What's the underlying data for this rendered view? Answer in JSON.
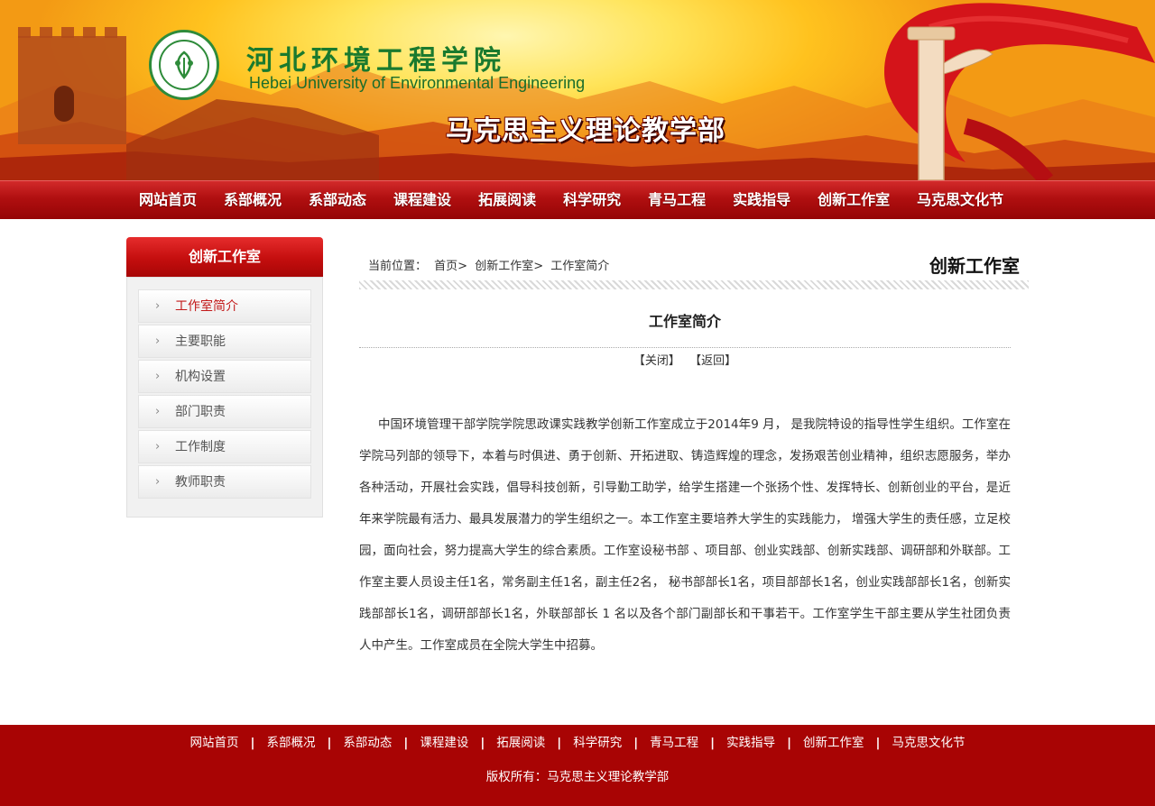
{
  "header": {
    "school_name_cn": "河北环境工程学院",
    "school_name_en": "Hebei University of Environmental Engineering",
    "department_title": "马克思主义理论教学部"
  },
  "nav": {
    "items": [
      "网站首页",
      "系部概况",
      "系部动态",
      "课程建设",
      "拓展阅读",
      "科学研究",
      "青马工程",
      "实践指导",
      "创新工作室",
      "马克思文化节"
    ]
  },
  "sidebar": {
    "title": "创新工作室",
    "items": [
      {
        "label": "工作室简介",
        "active": true
      },
      {
        "label": "主要职能"
      },
      {
        "label": "机构设置"
      },
      {
        "label": "部门职责"
      },
      {
        "label": "工作制度"
      },
      {
        "label": "教师职责"
      }
    ]
  },
  "breadcrumb": {
    "prefix": "当前位置：",
    "items": [
      "首页>",
      "创新工作室>",
      "工作室简介"
    ]
  },
  "section_title": "创新工作室",
  "article": {
    "title": "工作室简介",
    "close_link": "【关闭】",
    "back_link": "【返回】",
    "body": "中国环境管理干部学院学院思政课实践教学创新工作室成立于2014年9 月， 是我院特设的指导性学生组织。工作室在学院马列部的领导下，本着与时俱进、勇于创新、开拓进取、铸造辉煌的理念，发扬艰苦创业精神，组织志愿服务，举办各种活动，开展社会实践，倡导科技创新，引导勤工助学，给学生搭建一个张扬个性、发挥特长、创新创业的平台，是近年来学院最有活力、最具发展潜力的学生组织之一。本工作室主要培养大学生的实践能力， 增强大学生的责任感，立足校园，面向社会，努力提高大学生的综合素质。工作室设秘书部 、项目部、创业实践部、创新实践部、调研部和外联部。工作室主要人员设主任1名，常务副主任1名，副主任2名， 秘书部部长1名，项目部部长1名，创业实践部部长1名，创新实践部部长1名，调研部部长1名，外联部部长 1 名以及各个部门副部长和干事若干。工作室学生干部主要从学生社团负责人中产生。工作室成员在全院大学生中招募。"
  },
  "footer": {
    "links": [
      "网站首页",
      "系部概况",
      "系部动态",
      "课程建设",
      "拓展阅读",
      "科学研究",
      "青马工程",
      "实践指导",
      "创新工作室",
      "马克思文化节"
    ],
    "separator": "|",
    "copyright": "版权所有：马克思主义理论教学部"
  },
  "colors": {
    "primary_red": "#a80404",
    "nav_red": "#b00f10",
    "logo_green": "#1a7a2e",
    "active_link": "#c21a1a"
  }
}
